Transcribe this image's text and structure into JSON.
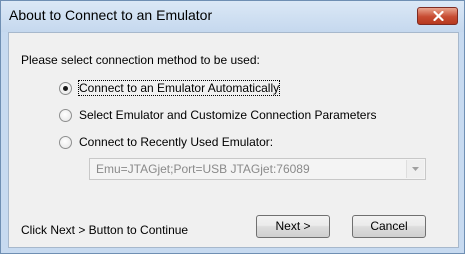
{
  "window": {
    "title": "About to Connect to an Emulator"
  },
  "dialog": {
    "prompt": "Please select connection method to be used:",
    "options": [
      {
        "label": "Connect to an Emulator Automatically",
        "selected": true
      },
      {
        "label": "Select Emulator and Customize Connection Parameters",
        "selected": false
      },
      {
        "label": "Connect to Recently Used Emulator:",
        "selected": false
      }
    ],
    "recent_emulator": {
      "value": "Emu=JTAGjet;Port=USB JTAGjet:76089",
      "enabled": false
    },
    "footer_text": "Click Next > Button to Continue",
    "next_label": "Next >",
    "cancel_label": "Cancel"
  },
  "colors": {
    "close_button": "#c74b32",
    "titlebar": "#c5d8ee"
  },
  "icons": {
    "close": "close-icon",
    "dropdown": "chevron-down-icon"
  }
}
